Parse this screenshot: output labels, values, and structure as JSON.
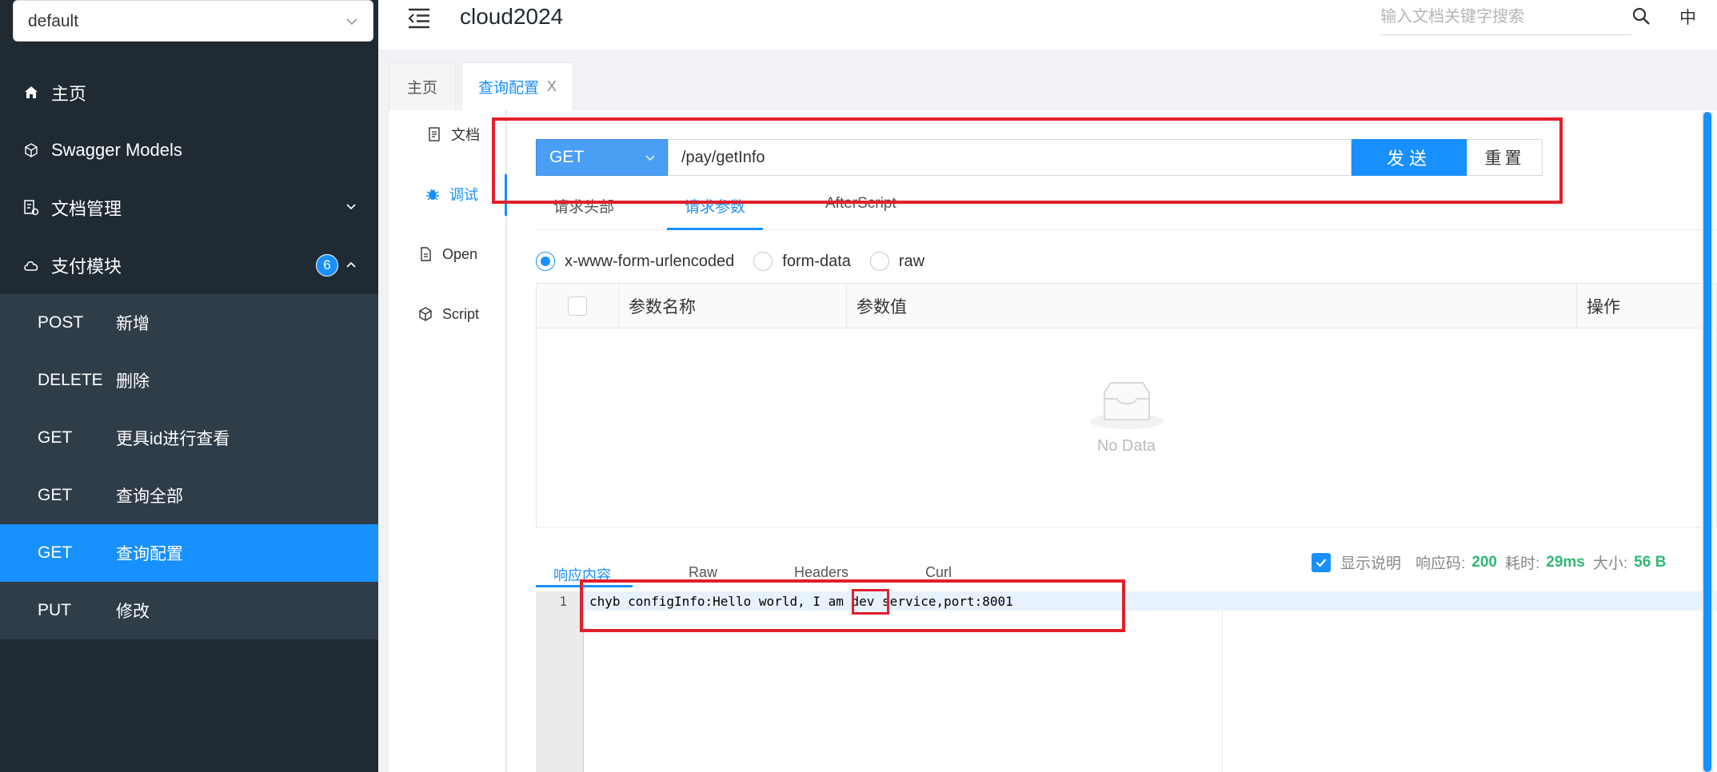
{
  "sidebar": {
    "group_select": "default",
    "menu": [
      {
        "label": "主页",
        "icon": "home-icon"
      },
      {
        "label": "Swagger Models",
        "icon": "cube-icon"
      },
      {
        "label": "文档管理",
        "icon": "doc-settings-icon"
      },
      {
        "label": "支付模块",
        "icon": "cloud-icon",
        "badge": "6"
      }
    ],
    "endpoints": [
      {
        "method": "POST",
        "label": "新增"
      },
      {
        "method": "DELETE",
        "label": "删除"
      },
      {
        "method": "GET",
        "label": "更具id进行查看"
      },
      {
        "method": "GET",
        "label": "查询全部"
      },
      {
        "method": "GET",
        "label": "查询配置"
      },
      {
        "method": "PUT",
        "label": "修改"
      }
    ]
  },
  "header": {
    "title": "cloud2024",
    "search_placeholder": "输入文档关键字搜索",
    "lang": "中"
  },
  "tabs": [
    {
      "label": "主页"
    },
    {
      "label": "查询配置",
      "close": "X"
    }
  ],
  "vtabs": [
    {
      "label": "文档"
    },
    {
      "label": "调试"
    },
    {
      "label": "Open"
    },
    {
      "label": "Script"
    }
  ],
  "request": {
    "method": "GET",
    "url": "/pay/getInfo",
    "send_label": "发送",
    "reset_label": "重置"
  },
  "request_tabs": [
    "请求头部",
    "请求参数",
    "AfterScript"
  ],
  "body_types": [
    "x-www-form-urlencoded",
    "form-data",
    "raw"
  ],
  "params_table": {
    "columns": [
      "参数名称",
      "参数值",
      "操作"
    ],
    "empty_text": "No Data"
  },
  "response": {
    "tabs": [
      "响应内容",
      "Raw",
      "Headers",
      "Curl"
    ],
    "show_desc_label": "显示说明",
    "code_label": "响应码:",
    "code_value": "200",
    "time_label": "耗时:",
    "time_value": "29ms",
    "size_label": "大小:",
    "size_value": "56 B",
    "line_number": "1",
    "body": "chyb configInfo:Hello world, I am dev service,port:8001"
  },
  "colors": {
    "accent": "#1890ff",
    "sidebar_bg": "#1f2a33",
    "highlight_red": "#e0202a",
    "success_green": "#2eb872"
  }
}
